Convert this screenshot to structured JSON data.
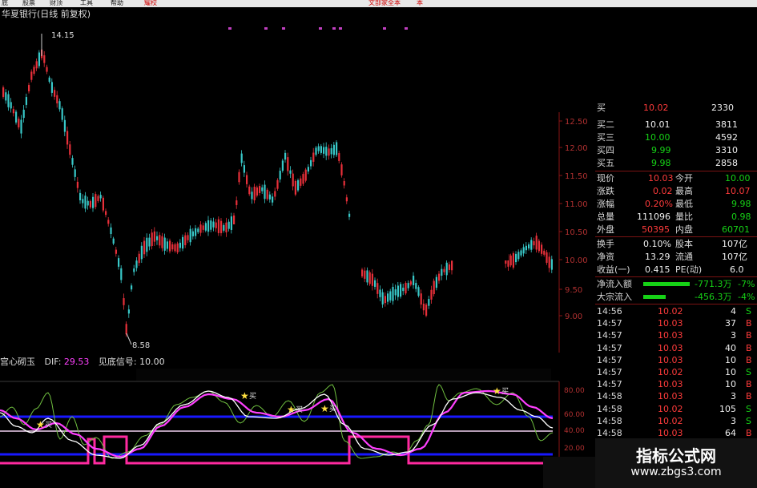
{
  "menubar": {
    "items": [
      "底",
      "股票",
      "财顶",
      "工具",
      "帮助",
      "耀校"
    ],
    "right_text": "文部家全本",
    "right_char": "本"
  },
  "stock": {
    "title": "华夏银行(日线 前复权)"
  },
  "main_chart": {
    "high_label": "14.15",
    "low_label": "8.58",
    "price_ticks": [
      "12.50",
      "12.00",
      "11.50",
      "11.00",
      "10.50",
      "10.00",
      "9.50",
      "9.00"
    ],
    "colors": {
      "up": "#e8303a",
      "down": "#38c8c8",
      "axis": "#8a1515"
    }
  },
  "bid_book": [
    {
      "label": "买二",
      "price": "10.01",
      "volume": "3811"
    },
    {
      "label": "买三",
      "price": "10.00",
      "volume": "4592"
    },
    {
      "label": "买四",
      "price": "9.99",
      "volume": "3310"
    },
    {
      "label": "买五",
      "price": "9.98",
      "volume": "2858"
    }
  ],
  "bid_top_partial": {
    "label": "买",
    "price": "10.02",
    "volume": "2330"
  },
  "quote": [
    {
      "l1": "现价",
      "v1": "10.03",
      "l2": "今开",
      "v2": "10.00"
    },
    {
      "l1": "涨跌",
      "v1": "0.02",
      "l2": "最高",
      "v2": "10.07"
    },
    {
      "l1": "涨幅",
      "v1": "0.20%",
      "l2": "最低",
      "v2": "9.98"
    },
    {
      "l1": "总量",
      "v1": "111096",
      "l2": "量比",
      "v2": "0.98"
    },
    {
      "l1": "外盘",
      "v1": "50395",
      "l2": "内盘",
      "v2": "60701"
    }
  ],
  "stats": [
    {
      "l1": "换手",
      "v1": "0.10%",
      "l2": "股本",
      "v2": "107亿"
    },
    {
      "l1": "净资",
      "v1": "13.29",
      "l2": "流通",
      "v2": "107亿"
    },
    {
      "l1": "收益(一)",
      "v1": "0.415",
      "l2": "PE(动)",
      "v2": "6.0"
    }
  ],
  "flows": [
    {
      "label": "净流入额",
      "value": "-771.3万",
      "pct": "-7%"
    },
    {
      "label": "大宗流入",
      "value": "-456.3万",
      "pct": "-4%"
    }
  ],
  "ticks": [
    {
      "time": "14:56",
      "price": "10.02",
      "vol": "4",
      "side": "S"
    },
    {
      "time": "14:57",
      "price": "10.03",
      "vol": "37",
      "side": "B"
    },
    {
      "time": "14:57",
      "price": "10.03",
      "vol": "3",
      "side": "B"
    },
    {
      "time": "14:57",
      "price": "10.03",
      "vol": "40",
      "side": "B"
    },
    {
      "time": "14:57",
      "price": "10.03",
      "vol": "10",
      "side": "B"
    },
    {
      "time": "14:57",
      "price": "10.02",
      "vol": "10",
      "side": "S"
    },
    {
      "time": "14:57",
      "price": "10.03",
      "vol": "10",
      "side": "B"
    },
    {
      "time": "14:58",
      "price": "10.03",
      "vol": "3",
      "side": "B"
    },
    {
      "time": "14:58",
      "price": "10.02",
      "vol": "105",
      "side": "S"
    },
    {
      "time": "14:58",
      "price": "10.02",
      "vol": "3",
      "side": "S"
    },
    {
      "time": "14:58",
      "price": "10.03",
      "vol": "64",
      "side": "B"
    }
  ],
  "indicator": {
    "name": "宫心砌玉",
    "dif_label": "DIF:",
    "dif_value": "29.53",
    "signal_label": "见底信号:",
    "signal_value": "10.00",
    "axis_ticks": [
      "80.00",
      "60.00",
      "40.00",
      "20.00"
    ],
    "buy_marker": "买",
    "colors": {
      "main": "#ff40ff",
      "fast": "#ffffff",
      "slow": "#70c040",
      "level": "#1818ff",
      "signal": "#ff2aa0"
    }
  },
  "watermark": {
    "line1": "指标公式网",
    "line2": "www.zbgs3.com"
  }
}
